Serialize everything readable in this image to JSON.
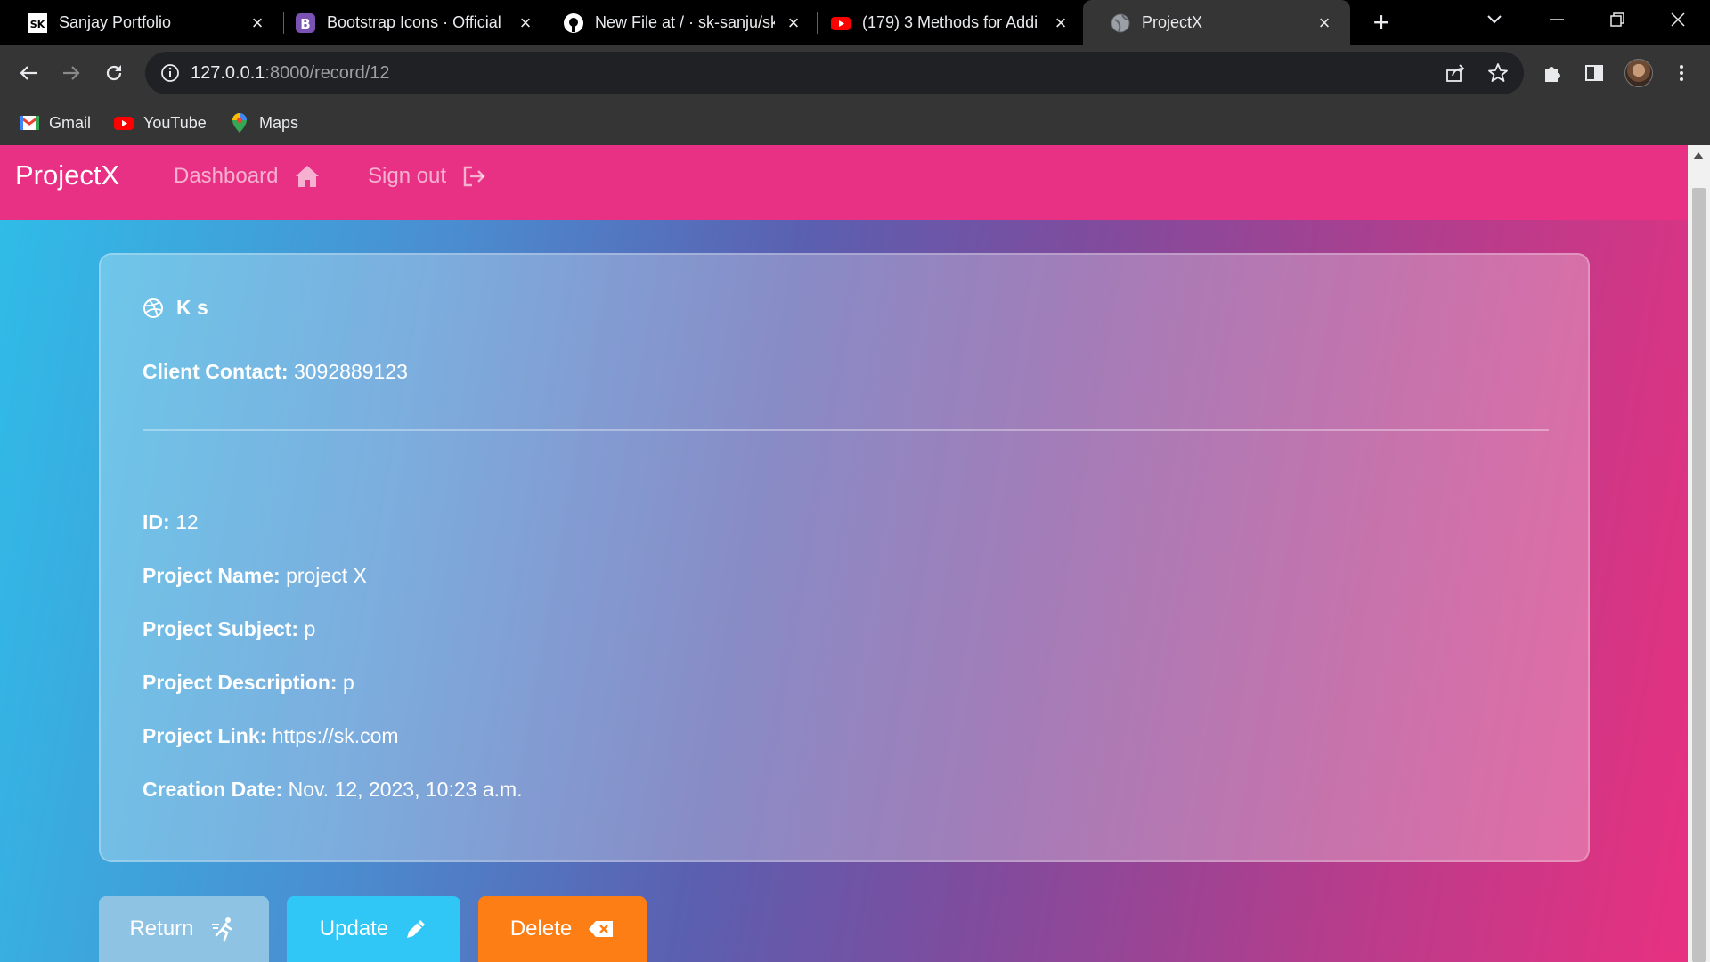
{
  "browser": {
    "tabs": [
      {
        "title": "Sanjay Portfolio",
        "icon": "sk-logo-icon"
      },
      {
        "title": "Bootstrap Icons · Official",
        "icon": "bootstrap-icon"
      },
      {
        "title": "New File at / · sk-sanju/sk",
        "icon": "github-icon"
      },
      {
        "title": "(179) 3 Methods for Addi",
        "icon": "youtube-icon"
      },
      {
        "title": "ProjectX",
        "icon": "globe-icon"
      }
    ],
    "url_host": "127.0.0.1",
    "url_path": ":8000/record/12",
    "bookmarks": [
      {
        "label": "Gmail",
        "icon": "gmail-icon"
      },
      {
        "label": "YouTube",
        "icon": "youtube-icon"
      },
      {
        "label": "Maps",
        "icon": "maps-icon"
      }
    ]
  },
  "navbar": {
    "brand": "ProjectX",
    "links": [
      {
        "label": "Dashboard",
        "icon": "house-icon"
      },
      {
        "label": "Sign out",
        "icon": "box-arrow-right-icon"
      }
    ],
    "color": "#e83184"
  },
  "record": {
    "client_name": "K s",
    "client_contact_label": "Client Contact:",
    "client_contact": "3092889123",
    "fields": [
      {
        "label": "ID:",
        "value": "12"
      },
      {
        "label": "Project Name:",
        "value": "project X"
      },
      {
        "label": "Project Subject:",
        "value": "p"
      },
      {
        "label": "Project Description:",
        "value": "p"
      },
      {
        "label": "Project Link:",
        "value": "https://sk.com"
      },
      {
        "label": "Creation Date:",
        "value": "Nov. 12, 2023, 10:23 a.m."
      }
    ]
  },
  "actions": {
    "return_label": "Return",
    "update_label": "Update",
    "delete_label": "Delete",
    "colors": {
      "return": "#8ec3e4",
      "update": "#30c6f5",
      "delete": "#fd7e14"
    }
  }
}
